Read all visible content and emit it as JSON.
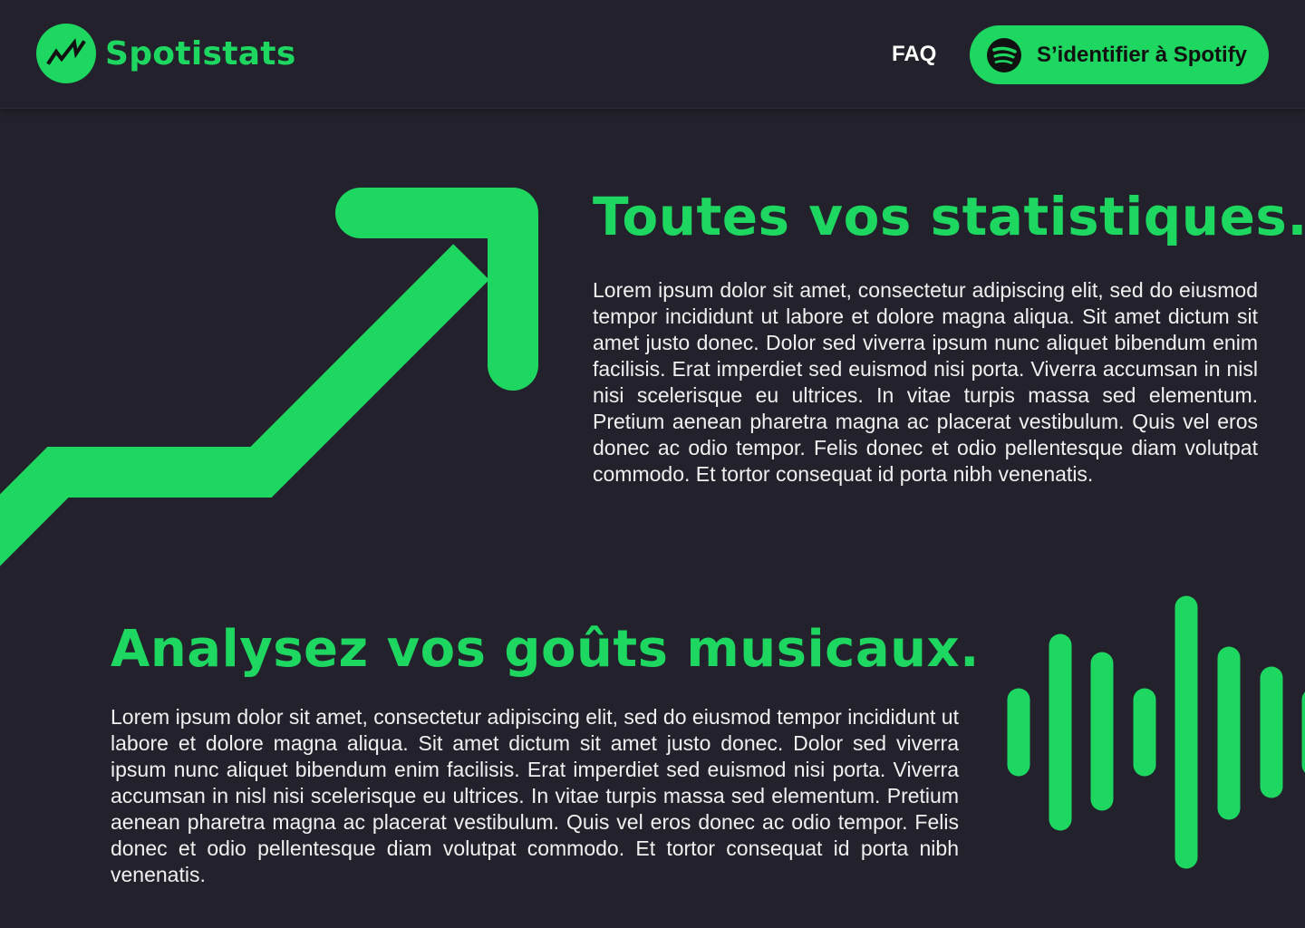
{
  "header": {
    "brand": "Spotistats",
    "nav_faq": "FAQ",
    "login_label": "S’identifier à Spotify"
  },
  "section1": {
    "title": "Toutes vos statistiques.",
    "text": "Lorem ipsum dolor sit amet, consectetur adipiscing elit, sed do eiusmod tempor incididunt ut labore et dolore magna aliqua. Sit amet dictum sit amet justo donec. Dolor sed viverra ipsum nunc aliquet bibendum enim facilisis. Erat imperdiet sed euismod nisi porta. Viverra accumsan in nisl nisi scelerisque eu ultrices. In vitae turpis massa sed elementum. Pretium aenean pharetra magna ac placerat vestibulum. Quis vel eros donec ac odio tempor. Felis donec et odio pellentesque diam volutpat commodo. Et tortor consequat id porta nibh venenatis."
  },
  "section2": {
    "title": "Analysez vos goûts musicaux.",
    "text": "Lorem ipsum dolor sit amet, consectetur adipiscing elit, sed do eiusmod tempor incididunt ut labore et dolore magna aliqua. Sit amet dictum sit amet justo donec. Dolor sed viverra ipsum nunc aliquet bibendum enim facilisis. Erat imperdiet sed euismod nisi porta. Viverra accumsan in nisl nisi scelerisque eu ultrices. In vitae turpis massa sed elementum. Pretium aenean pharetra magna ac placerat vestibulum. Quis vel eros donec ac odio tempor. Felis donec et odio pellentesque diam volutpat commodo. Et tortor consequat id porta nibh venenatis."
  },
  "icons": {
    "logo": "trending-chart-icon",
    "login": "spotify-icon",
    "illustration1": "trending-up-arrow-icon",
    "illustration2": "sound-wave-icon"
  },
  "colors": {
    "accent": "#1ed760",
    "background": "#23222c",
    "text": "#f0f0f0"
  }
}
